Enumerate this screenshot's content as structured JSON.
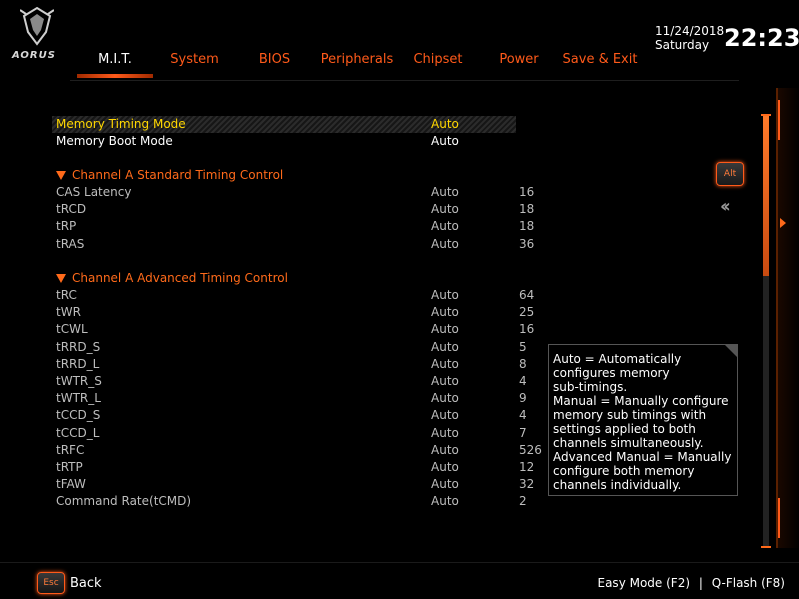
{
  "brand": {
    "logo_text": "AORUS",
    "colors": {
      "accent": "#ff5a1a",
      "selected": "#ffd700"
    }
  },
  "header": {
    "tabs": [
      {
        "label": "M.I.T.",
        "active": true
      },
      {
        "label": "System"
      },
      {
        "label": "BIOS"
      },
      {
        "label": "Peripherals"
      },
      {
        "label": "Chipset"
      },
      {
        "label": "Power"
      },
      {
        "label": "Save & Exit"
      }
    ],
    "date": "11/24/2018",
    "day": "Saturday",
    "time": "22:23"
  },
  "settings": {
    "memory_timing_mode": {
      "label": "Memory Timing Mode",
      "value": "Auto"
    },
    "memory_boot_mode": {
      "label": "Memory Boot Mode",
      "value": "Auto"
    },
    "standard_section": "Channel A Standard Timing Control",
    "standard": [
      {
        "label": "CAS Latency",
        "value": "Auto",
        "current": "16"
      },
      {
        "label": "tRCD",
        "value": "Auto",
        "current": "18"
      },
      {
        "label": "tRP",
        "value": "Auto",
        "current": "18"
      },
      {
        "label": "tRAS",
        "value": "Auto",
        "current": "36"
      }
    ],
    "advanced_section": "Channel A Advanced Timing Control",
    "advanced": [
      {
        "label": "tRC",
        "value": "Auto",
        "current": "64"
      },
      {
        "label": "tWR",
        "value": "Auto",
        "current": "25"
      },
      {
        "label": "tCWL",
        "value": "Auto",
        "current": "16"
      },
      {
        "label": "tRRD_S",
        "value": "Auto",
        "current": "5"
      },
      {
        "label": "tRRD_L",
        "value": "Auto",
        "current": "8"
      },
      {
        "label": "tWTR_S",
        "value": "Auto",
        "current": "4"
      },
      {
        "label": "tWTR_L",
        "value": "Auto",
        "current": "9"
      },
      {
        "label": "tCCD_S",
        "value": "Auto",
        "current": "4"
      },
      {
        "label": "tCCD_L",
        "value": "Auto",
        "current": "7"
      },
      {
        "label": "tRFC",
        "value": "Auto",
        "current": "526"
      },
      {
        "label": "tRTP",
        "value": "Auto",
        "current": "12"
      },
      {
        "label": "tFAW",
        "value": "Auto",
        "current": "32"
      },
      {
        "label": "Command Rate(tCMD)",
        "value": "Auto",
        "current": "2"
      }
    ]
  },
  "help": {
    "lines": [
      "Auto = Automatically",
      "configures memory",
      "sub-timings.",
      "Manual = Manually configure",
      "memory sub timings with",
      "settings applied to both",
      "channels simultaneously.",
      "Advanced Manual = Manually",
      "configure both memory",
      "channels individually."
    ]
  },
  "side": {
    "alt_label": "Alt",
    "collapse_icon": "double-chevron-left-icon"
  },
  "footer": {
    "esc_label": "Esc",
    "back_label": "Back",
    "easy_mode": "Easy Mode (F2)",
    "separator": "|",
    "qflash": "Q-Flash (F8)"
  }
}
